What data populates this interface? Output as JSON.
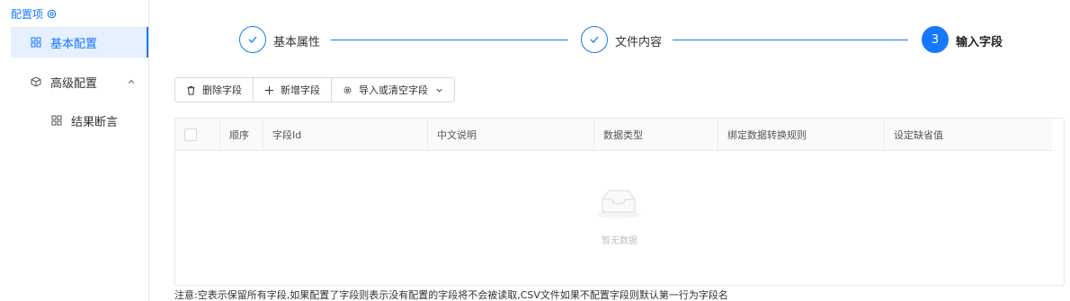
{
  "sidebar": {
    "title": "配置项",
    "title_icon": "settings-icon",
    "items": [
      {
        "label": "基本配置",
        "icon": "grid-icon",
        "active": true
      },
      {
        "label": "高级配置",
        "icon": "cube-icon",
        "expanded": true
      },
      {
        "label": "结果断言",
        "icon": "grid-icon",
        "sub": true
      }
    ]
  },
  "steps": [
    {
      "label": "基本属性",
      "state": "done"
    },
    {
      "label": "文件内容",
      "state": "done"
    },
    {
      "label": "输入字段",
      "state": "current",
      "number": "3"
    }
  ],
  "toolbar": {
    "delete_label": "删除字段",
    "add_label": "新增字段",
    "import_label": "导入或清空字段"
  },
  "table": {
    "columns": [
      "顺序",
      "字段Id",
      "中文说明",
      "数据类型",
      "绑定数据转换规则",
      "设定缺省值"
    ],
    "rows": [],
    "empty_text": "暂无数据"
  },
  "note": "注意:空表示保留所有字段,如果配置了字段则表示没有配置的字段将不会被读取,CSV文件如果不配置字段则默认第一行为字段名",
  "colors": {
    "accent": "#1677ff",
    "active_bg": "#e6f0ff",
    "border": "#e8e8e8"
  }
}
